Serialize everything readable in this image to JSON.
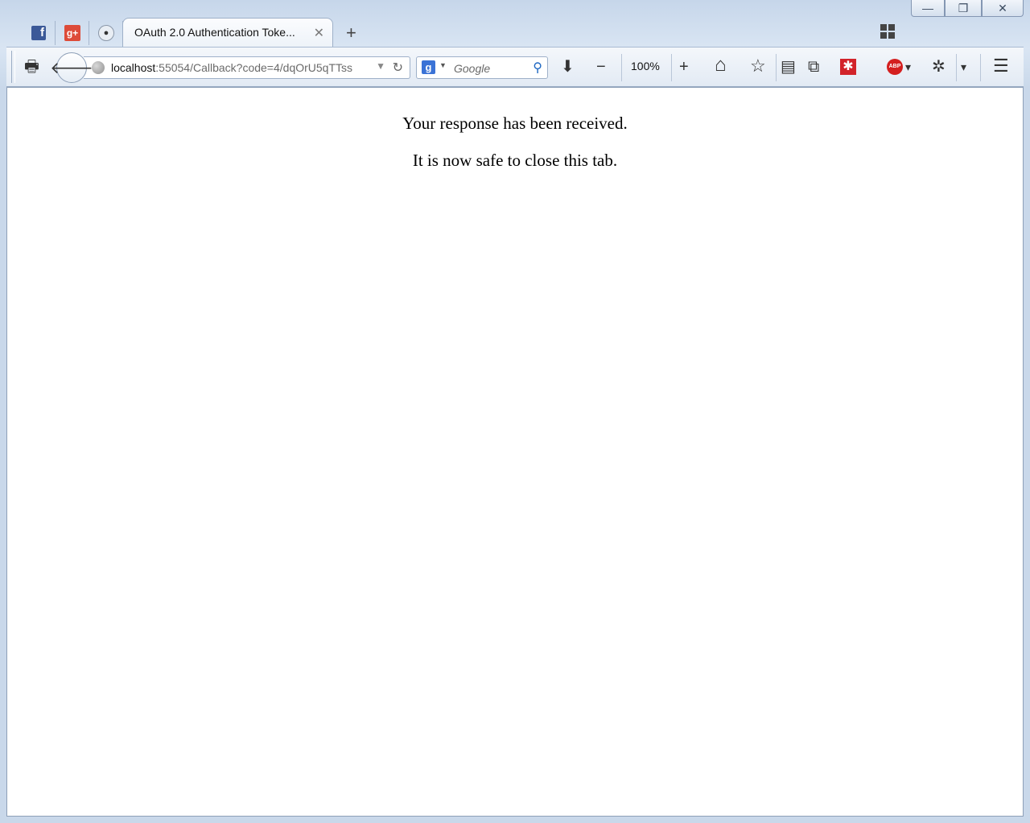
{
  "window_controls": {
    "minimize": "—",
    "restore": "❐",
    "close": "✕"
  },
  "tabs": {
    "pinned": [
      {
        "icon": "facebook-icon",
        "glyph": "f"
      },
      {
        "icon": "google-plus-icon",
        "glyph": "g+"
      },
      {
        "icon": "reddit-icon",
        "glyph": "●"
      }
    ],
    "active": {
      "title": "OAuth 2.0 Authentication Toke...",
      "close": "✕"
    },
    "new_tab": "+"
  },
  "toolbar": {
    "print": "🖶",
    "back": "🡐",
    "url_host": "localhost",
    "url_rest": ":55054/Callback?code=4/dqOrU5qTTss",
    "url_drop": "▼",
    "reload": "↻",
    "search_engine_glyph": "g",
    "search_drop": "▼",
    "search_placeholder": "Google",
    "search_icon": "⚲",
    "download": "⬇",
    "zoom_out": "−",
    "zoom_level": "100%",
    "zoom_in": "+",
    "home": "⌂",
    "bookmark": "☆",
    "reading_list": "▤",
    "evernote": "⧉",
    "lastpass": "✱",
    "abp": "ABP",
    "abp_drop": "▾",
    "bug": "✲",
    "bug_drop": "▾",
    "menu": "☰"
  },
  "page": {
    "line1": "Your response has been received.",
    "line2": "It is now safe to close this tab."
  }
}
